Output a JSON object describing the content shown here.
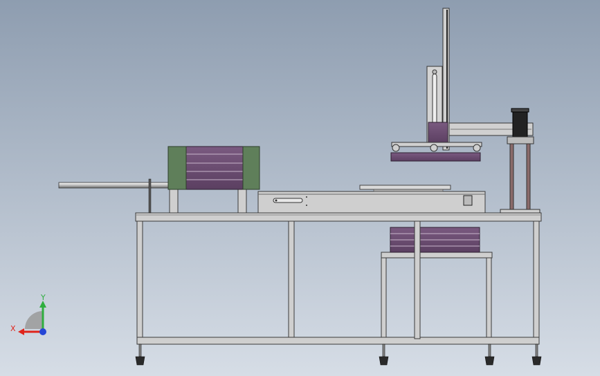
{
  "viewport": {
    "background_top": "#8e9db0",
    "background_bottom": "#d6dde6"
  },
  "colors": {
    "frame_fill": "#c9c9c9",
    "frame_stroke": "#3a3a3a",
    "purple": "#6f4f75",
    "purple_line": "#c9b6cc",
    "green": "#5f7f5a",
    "shaft": "#e6e6e6",
    "foot": "#2a2a2a",
    "axis_x": "#e0241b",
    "axis_y": "#2fae3f",
    "axis_z": "#2546d6"
  },
  "triad": {
    "x_label": "X",
    "y_label": "Y"
  },
  "icons": {
    "triad": "coordinate-triad-icon"
  }
}
